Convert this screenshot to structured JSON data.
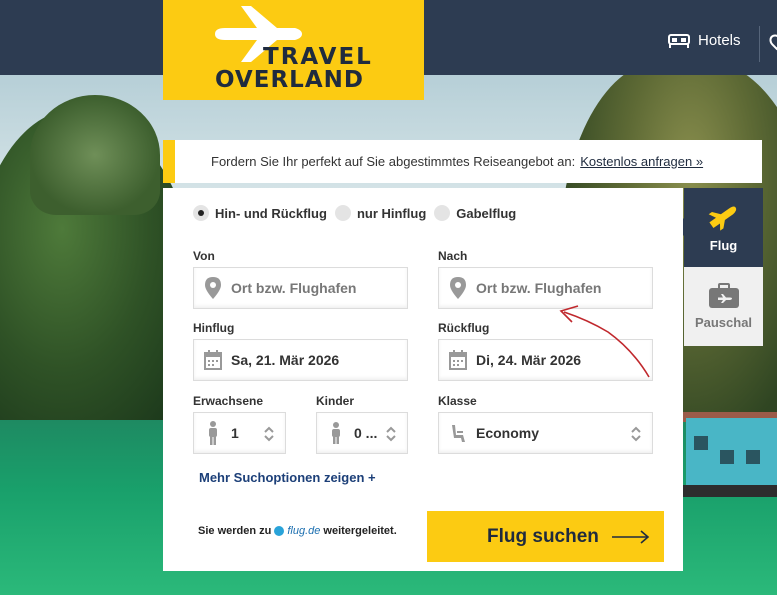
{
  "header": {
    "logo_line1": "TRAVEL",
    "logo_line2": "OVERLAND",
    "nav_hotels": "Hotels"
  },
  "notice": {
    "text": "Fordern Sie Ihr perfekt auf Sie abgestimmtes Reiseangebot an:",
    "link": "Kostenlos anfragen »"
  },
  "trip_type": {
    "options": [
      "Hin- und Rückflug",
      "nur Hinflug",
      "Gabelflug"
    ],
    "selected": "Hin- und Rückflug"
  },
  "form": {
    "from_label": "Von",
    "from_placeholder": "Ort bzw. Flughafen",
    "to_label": "Nach",
    "to_placeholder": "Ort bzw. Flughafen",
    "depart_label": "Hinflug",
    "depart_value": "Sa, 21. Mär 2026",
    "return_label": "Rückflug",
    "return_value": "Di, 24. Mär 2026",
    "adults_label": "Erwachsene",
    "adults_value": "1",
    "children_label": "Kinder",
    "children_value": "0 ...",
    "class_label": "Klasse",
    "class_value": "Economy",
    "more_options": "Mehr Suchoptionen zeigen +",
    "redirect_prefix": "Sie werden zu",
    "redirect_brand": "flug.de",
    "redirect_suffix": "weitergeleitet.",
    "search_button": "Flug suchen"
  },
  "tabs": {
    "flight": "Flug",
    "package": "Pauschal"
  },
  "colors": {
    "accent": "#fccb12",
    "navy": "#2d3c52",
    "link": "#1c3f78",
    "annotation": "#c0282d"
  }
}
